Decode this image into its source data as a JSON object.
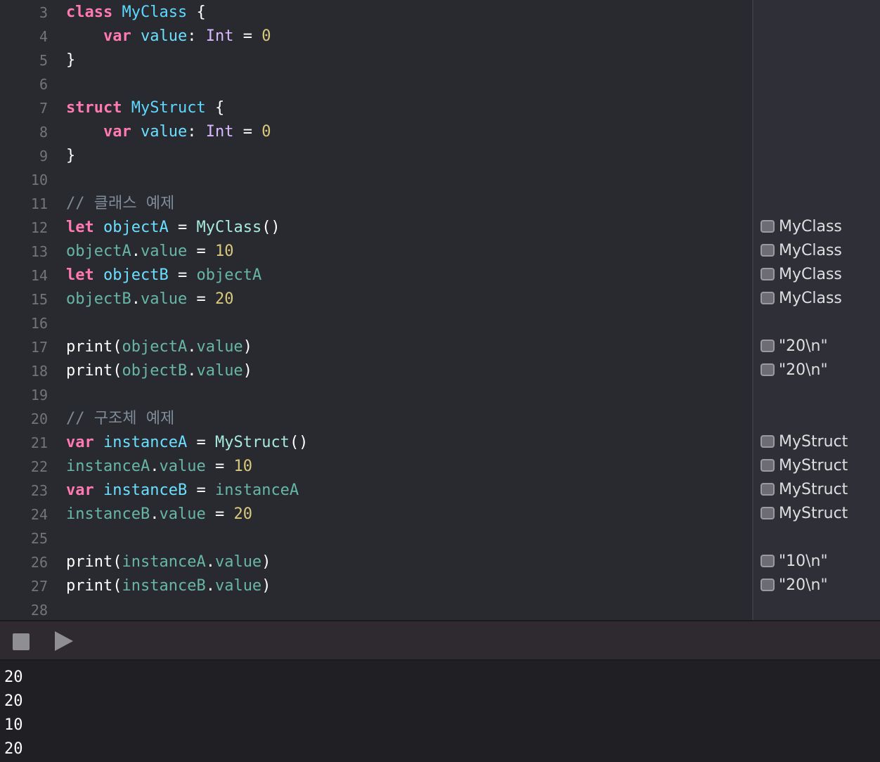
{
  "editor": {
    "lines": [
      {
        "n": "3",
        "tokens": [
          [
            "kw",
            "class"
          ],
          [
            "plain",
            " "
          ],
          [
            "typedecl",
            "MyClass"
          ],
          [
            "plain",
            " {"
          ]
        ]
      },
      {
        "n": "4",
        "tokens": [
          [
            "plain",
            "    "
          ],
          [
            "kw",
            "var"
          ],
          [
            "plain",
            " "
          ],
          [
            "type",
            "value"
          ],
          [
            "plain",
            ": "
          ],
          [
            "tyuse",
            "Int"
          ],
          [
            "plain",
            " = "
          ],
          [
            "num",
            "0"
          ]
        ]
      },
      {
        "n": "5",
        "tokens": [
          [
            "plain",
            "}"
          ]
        ]
      },
      {
        "n": "6",
        "tokens": []
      },
      {
        "n": "7",
        "tokens": [
          [
            "kw",
            "struct"
          ],
          [
            "plain",
            " "
          ],
          [
            "typedecl",
            "MyStruct"
          ],
          [
            "plain",
            " {"
          ]
        ]
      },
      {
        "n": "8",
        "tokens": [
          [
            "plain",
            "    "
          ],
          [
            "kw",
            "var"
          ],
          [
            "plain",
            " "
          ],
          [
            "type",
            "value"
          ],
          [
            "plain",
            ": "
          ],
          [
            "tyuse",
            "Int"
          ],
          [
            "plain",
            " = "
          ],
          [
            "num",
            "0"
          ]
        ]
      },
      {
        "n": "9",
        "tokens": [
          [
            "plain",
            "}"
          ]
        ]
      },
      {
        "n": "10",
        "tokens": []
      },
      {
        "n": "11",
        "tokens": [
          [
            "cmt",
            "// 클래스 예제"
          ]
        ]
      },
      {
        "n": "12",
        "tokens": [
          [
            "kw",
            "let"
          ],
          [
            "plain",
            " "
          ],
          [
            "type",
            "objectA"
          ],
          [
            "plain",
            " = "
          ],
          [
            "fn",
            "MyClass"
          ],
          [
            "plain",
            "()"
          ]
        ]
      },
      {
        "n": "13",
        "tokens": [
          [
            "prop",
            "objectA"
          ],
          [
            "plain",
            "."
          ],
          [
            "prop",
            "value"
          ],
          [
            "plain",
            " = "
          ],
          [
            "num",
            "10"
          ]
        ]
      },
      {
        "n": "14",
        "tokens": [
          [
            "kw",
            "let"
          ],
          [
            "plain",
            " "
          ],
          [
            "type",
            "objectB"
          ],
          [
            "plain",
            " = "
          ],
          [
            "prop",
            "objectA"
          ]
        ]
      },
      {
        "n": "15",
        "tokens": [
          [
            "prop",
            "objectB"
          ],
          [
            "plain",
            "."
          ],
          [
            "prop",
            "value"
          ],
          [
            "plain",
            " = "
          ],
          [
            "num",
            "20"
          ]
        ]
      },
      {
        "n": "16",
        "tokens": []
      },
      {
        "n": "17",
        "tokens": [
          [
            "plain",
            "print("
          ],
          [
            "prop",
            "objectA"
          ],
          [
            "plain",
            "."
          ],
          [
            "prop",
            "value"
          ],
          [
            "plain",
            ")"
          ]
        ]
      },
      {
        "n": "18",
        "tokens": [
          [
            "plain",
            "print("
          ],
          [
            "prop",
            "objectB"
          ],
          [
            "plain",
            "."
          ],
          [
            "prop",
            "value"
          ],
          [
            "plain",
            ")"
          ]
        ]
      },
      {
        "n": "19",
        "tokens": []
      },
      {
        "n": "20",
        "tokens": [
          [
            "cmt",
            "// 구조체 예제"
          ]
        ]
      },
      {
        "n": "21",
        "tokens": [
          [
            "kw",
            "var"
          ],
          [
            "plain",
            " "
          ],
          [
            "type",
            "instanceA"
          ],
          [
            "plain",
            " = "
          ],
          [
            "fn",
            "MyStruct"
          ],
          [
            "plain",
            "()"
          ]
        ]
      },
      {
        "n": "22",
        "tokens": [
          [
            "prop",
            "instanceA"
          ],
          [
            "plain",
            "."
          ],
          [
            "prop",
            "value"
          ],
          [
            "plain",
            " = "
          ],
          [
            "num",
            "10"
          ]
        ]
      },
      {
        "n": "23",
        "tokens": [
          [
            "kw",
            "var"
          ],
          [
            "plain",
            " "
          ],
          [
            "type",
            "instanceB"
          ],
          [
            "plain",
            " = "
          ],
          [
            "prop",
            "instanceA"
          ]
        ]
      },
      {
        "n": "24",
        "tokens": [
          [
            "prop",
            "instanceB"
          ],
          [
            "plain",
            "."
          ],
          [
            "prop",
            "value"
          ],
          [
            "plain",
            " = "
          ],
          [
            "num",
            "20"
          ]
        ]
      },
      {
        "n": "25",
        "tokens": []
      },
      {
        "n": "26",
        "tokens": [
          [
            "plain",
            "print("
          ],
          [
            "prop",
            "instanceA"
          ],
          [
            "plain",
            "."
          ],
          [
            "prop",
            "value"
          ],
          [
            "plain",
            ")"
          ]
        ]
      },
      {
        "n": "27",
        "tokens": [
          [
            "plain",
            "print("
          ],
          [
            "prop",
            "instanceB"
          ],
          [
            "plain",
            "."
          ],
          [
            "prop",
            "value"
          ],
          [
            "plain",
            ")"
          ]
        ]
      },
      {
        "n": "28",
        "tokens": []
      }
    ]
  },
  "results": [
    {
      "line": "12",
      "text": "MyClass"
    },
    {
      "line": "13",
      "text": "MyClass"
    },
    {
      "line": "14",
      "text": "MyClass"
    },
    {
      "line": "15",
      "text": "MyClass"
    },
    {
      "line": "17",
      "text": "\"20\\n\""
    },
    {
      "line": "18",
      "text": "\"20\\n\""
    },
    {
      "line": "21",
      "text": "MyStruct"
    },
    {
      "line": "22",
      "text": "MyStruct"
    },
    {
      "line": "23",
      "text": "MyStruct"
    },
    {
      "line": "24",
      "text": "MyStruct"
    },
    {
      "line": "26",
      "text": "\"10\\n\""
    },
    {
      "line": "27",
      "text": "\"20\\n\""
    }
  ],
  "toolbar": {
    "stop_icon": "stop-icon",
    "run_icon": "play-icon"
  },
  "console": {
    "output": [
      "20",
      "20",
      "10",
      "20"
    ]
  },
  "colors": {
    "keyword": "#ff7ab2",
    "type_decl": "#5dd8ff",
    "property": "#67b7a4",
    "number": "#d9c97c",
    "comment": "#7f8c98",
    "background": "#292a30"
  }
}
